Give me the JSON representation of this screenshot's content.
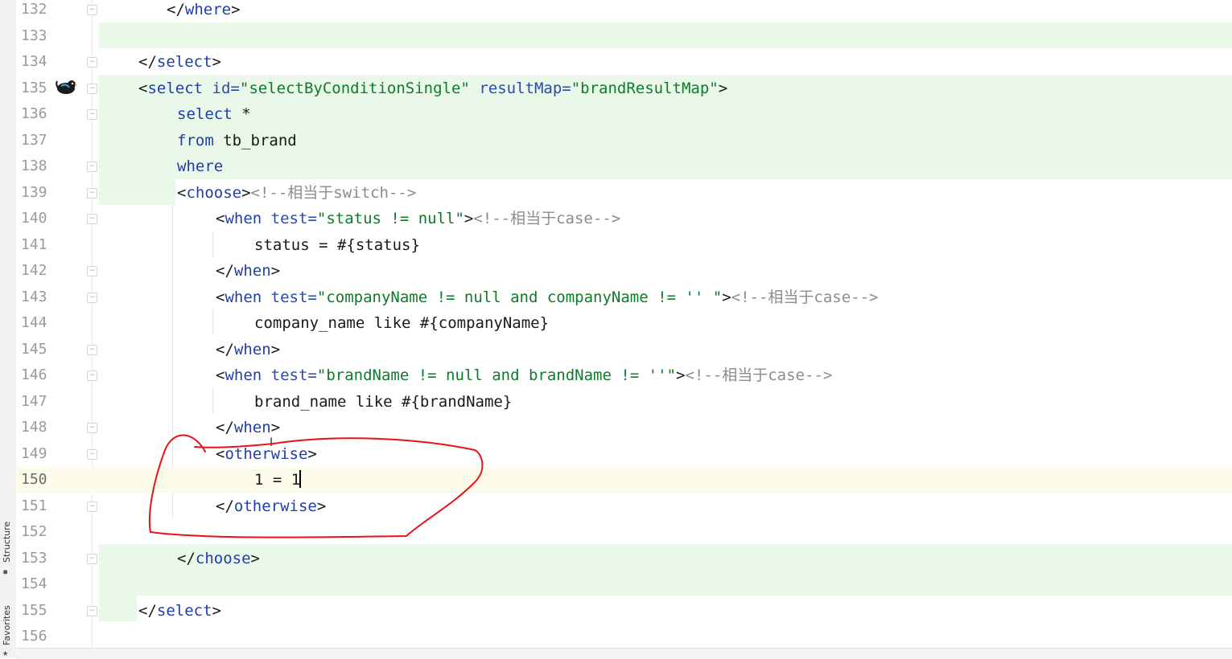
{
  "editor": {
    "side_tabs": {
      "structure": "Structure",
      "favorites": "Favorites"
    },
    "current_line": 150,
    "lines": [
      {
        "num": "132",
        "text": "</where>"
      },
      {
        "num": "133",
        "text": ""
      },
      {
        "num": "134",
        "text": "</select>"
      },
      {
        "num": "135",
        "text": "<select id=\"selectByConditionSingle\" resultMap=\"brandResultMap\">"
      },
      {
        "num": "136",
        "text": "select *"
      },
      {
        "num": "137",
        "text": "from tb_brand"
      },
      {
        "num": "138",
        "text": "where"
      },
      {
        "num": "139",
        "text": "<choose><!--相当于switch-->"
      },
      {
        "num": "140",
        "text": "<when test=\"status != null\"><!--相当于case-->"
      },
      {
        "num": "141",
        "text": "status = #{status}"
      },
      {
        "num": "142",
        "text": "</when>"
      },
      {
        "num": "143",
        "text": "<when test=\"companyName != null and companyName != '' \"><!--相当于case-->"
      },
      {
        "num": "144",
        "text": "company_name like #{companyName}"
      },
      {
        "num": "145",
        "text": "</when>"
      },
      {
        "num": "146",
        "text": "<when test=\"brandName != null and brandName != ''\"><!--相当于case-->"
      },
      {
        "num": "147",
        "text": "brand_name like #{brandName}"
      },
      {
        "num": "148",
        "text": "</when>"
      },
      {
        "num": "149",
        "text": "<otherwise>"
      },
      {
        "num": "150",
        "text": "1 = 1"
      },
      {
        "num": "151",
        "text": "</otherwise>"
      },
      {
        "num": "152",
        "text": ""
      },
      {
        "num": "153",
        "text": "</choose>"
      },
      {
        "num": "154",
        "text": ""
      },
      {
        "num": "155",
        "text": "</select>"
      },
      {
        "num": "156",
        "text": ""
      }
    ]
  },
  "colors": {
    "tag_name": "#1f3ea8",
    "attr_value": "#0f7a2a",
    "comment": "#8c8c8c",
    "diff_highlight": "#eaf8ea",
    "current_line": "#fdfbea",
    "annotation": "#e8121b"
  },
  "icons": {
    "gutter_marker": "mybatis-bird-icon",
    "fold_marker": "fold-icon"
  }
}
